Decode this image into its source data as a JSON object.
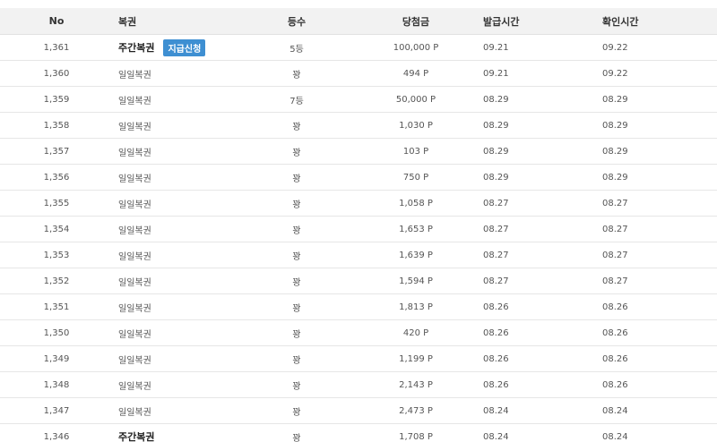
{
  "table": {
    "headers": {
      "no": "No",
      "kind": "복권",
      "grade": "등수",
      "amount": "당첨금",
      "issued": "발급시간",
      "checked": "확인시간"
    },
    "rows": [
      {
        "no": "1,361",
        "kind": "주간복권",
        "bold": true,
        "action": "지급신청",
        "grade": "5등",
        "amount": "100,000 P",
        "issued": "09.21",
        "checked": "09.22"
      },
      {
        "no": "1,360",
        "kind": "일일복권",
        "bold": false,
        "action": "",
        "grade": "꽝",
        "amount": "494 P",
        "issued": "09.21",
        "checked": "09.22"
      },
      {
        "no": "1,359",
        "kind": "일일복권",
        "bold": false,
        "action": "",
        "grade": "7등",
        "amount": "50,000 P",
        "issued": "08.29",
        "checked": "08.29"
      },
      {
        "no": "1,358",
        "kind": "일일복권",
        "bold": false,
        "action": "",
        "grade": "꽝",
        "amount": "1,030 P",
        "issued": "08.29",
        "checked": "08.29"
      },
      {
        "no": "1,357",
        "kind": "일일복권",
        "bold": false,
        "action": "",
        "grade": "꽝",
        "amount": "103 P",
        "issued": "08.29",
        "checked": "08.29"
      },
      {
        "no": "1,356",
        "kind": "일일복권",
        "bold": false,
        "action": "",
        "grade": "꽝",
        "amount": "750 P",
        "issued": "08.29",
        "checked": "08.29"
      },
      {
        "no": "1,355",
        "kind": "일일복권",
        "bold": false,
        "action": "",
        "grade": "꽝",
        "amount": "1,058 P",
        "issued": "08.27",
        "checked": "08.27"
      },
      {
        "no": "1,354",
        "kind": "일일복권",
        "bold": false,
        "action": "",
        "grade": "꽝",
        "amount": "1,653 P",
        "issued": "08.27",
        "checked": "08.27"
      },
      {
        "no": "1,353",
        "kind": "일일복권",
        "bold": false,
        "action": "",
        "grade": "꽝",
        "amount": "1,639 P",
        "issued": "08.27",
        "checked": "08.27"
      },
      {
        "no": "1,352",
        "kind": "일일복권",
        "bold": false,
        "action": "",
        "grade": "꽝",
        "amount": "1,594 P",
        "issued": "08.27",
        "checked": "08.27"
      },
      {
        "no": "1,351",
        "kind": "일일복권",
        "bold": false,
        "action": "",
        "grade": "꽝",
        "amount": "1,813 P",
        "issued": "08.26",
        "checked": "08.26"
      },
      {
        "no": "1,350",
        "kind": "일일복권",
        "bold": false,
        "action": "",
        "grade": "꽝",
        "amount": "420 P",
        "issued": "08.26",
        "checked": "08.26"
      },
      {
        "no": "1,349",
        "kind": "일일복권",
        "bold": false,
        "action": "",
        "grade": "꽝",
        "amount": "1,199 P",
        "issued": "08.26",
        "checked": "08.26"
      },
      {
        "no": "1,348",
        "kind": "일일복권",
        "bold": false,
        "action": "",
        "grade": "꽝",
        "amount": "2,143 P",
        "issued": "08.26",
        "checked": "08.26"
      },
      {
        "no": "1,347",
        "kind": "일일복권",
        "bold": false,
        "action": "",
        "grade": "꽝",
        "amount": "2,473 P",
        "issued": "08.24",
        "checked": "08.24"
      },
      {
        "no": "1,346",
        "kind": "주간복권",
        "bold": true,
        "action": "",
        "grade": "꽝",
        "amount": "1,708 P",
        "issued": "08.24",
        "checked": "08.24"
      }
    ]
  },
  "colors": {
    "header_bg": "#f2f2f2",
    "button_bg": "#3e8fd2",
    "row_border": "#e6e6e6"
  }
}
